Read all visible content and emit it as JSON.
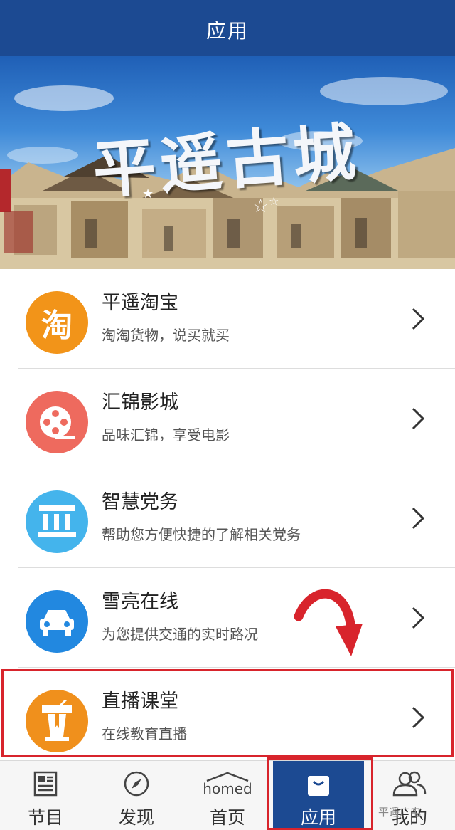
{
  "header": {
    "title": "应用"
  },
  "banner": {
    "title": "平遥古城"
  },
  "apps": [
    {
      "title": "平遥淘宝",
      "subtitle": "淘淘货物，说买就买",
      "icon": "taobao-icon",
      "icon_text": "淘",
      "color": "#f29419"
    },
    {
      "title": "汇锦影城",
      "subtitle": "品味汇锦，享受电影",
      "icon": "film-reel-icon",
      "color": "#ee6a5e"
    },
    {
      "title": "智慧党务",
      "subtitle": "帮助您方便快捷的了解相关党务",
      "icon": "government-building-icon",
      "color": "#44b4ec"
    },
    {
      "title": "雪亮在线",
      "subtitle": "为您提供交通的实时路况",
      "icon": "car-icon",
      "color": "#2288e0"
    },
    {
      "title": "直播课堂",
      "subtitle": "在线教育直播",
      "icon": "lectern-icon",
      "color": "#f0901c"
    }
  ],
  "tabs": [
    {
      "label": "节目",
      "icon": "newspaper-icon"
    },
    {
      "label": "发现",
      "icon": "compass-icon"
    },
    {
      "label": "首页",
      "icon": "home-icon",
      "logo_text": "homed"
    },
    {
      "label": "应用",
      "icon": "shopping-bag-icon",
      "active": true
    },
    {
      "label": "我的",
      "icon": "users-icon"
    }
  ],
  "watermark": "平遥广电",
  "colors": {
    "brand": "#1c4a92",
    "highlight": "#d8242c"
  }
}
